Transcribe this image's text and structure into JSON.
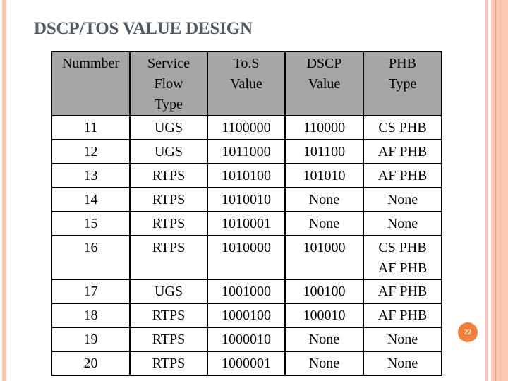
{
  "slide": {
    "title": "DSCP/TOS VALUE DESIGN",
    "slide_number": "22",
    "accent_color": "#f47f3a",
    "border_color": "#fbc3ae"
  },
  "table": {
    "headers": [
      [
        "Nummber"
      ],
      [
        "Service",
        "Flow",
        "Type"
      ],
      [
        "To.S",
        "Value"
      ],
      [
        "DSCP",
        "Value"
      ],
      [
        "PHB",
        "Type"
      ]
    ],
    "header_background": "#a6a6a6",
    "rows": [
      {
        "number": "11",
        "service_flow_type": "UGS",
        "tos_value": "1100000",
        "dscp_value": "110000",
        "phb_type": [
          "CS PHB"
        ]
      },
      {
        "number": "12",
        "service_flow_type": "UGS",
        "tos_value": "1011000",
        "dscp_value": "101100",
        "phb_type": [
          "AF PHB"
        ]
      },
      {
        "number": "13",
        "service_flow_type": "RTPS",
        "tos_value": "1010100",
        "dscp_value": "101010",
        "phb_type": [
          "AF PHB"
        ]
      },
      {
        "number": "14",
        "service_flow_type": "RTPS",
        "tos_value": "1010010",
        "dscp_value": "None",
        "phb_type": [
          "None"
        ]
      },
      {
        "number": "15",
        "service_flow_type": "RTPS",
        "tos_value": "1010001",
        "dscp_value": "None",
        "phb_type": [
          "None"
        ]
      },
      {
        "number": "16",
        "service_flow_type": "RTPS",
        "tos_value": "1010000",
        "dscp_value": "101000",
        "phb_type": [
          "CS PHB",
          "AF PHB"
        ]
      },
      {
        "number": "17",
        "service_flow_type": "UGS",
        "tos_value": "1001000",
        "dscp_value": "100100",
        "phb_type": [
          "AF PHB"
        ]
      },
      {
        "number": "18",
        "service_flow_type": "RTPS",
        "tos_value": "1000100",
        "dscp_value": "100010",
        "phb_type": [
          "AF PHB"
        ]
      },
      {
        "number": "19",
        "service_flow_type": "RTPS",
        "tos_value": "1000010",
        "dscp_value": "None",
        "phb_type": [
          "None"
        ]
      },
      {
        "number": "20",
        "service_flow_type": "RTPS",
        "tos_value": "1000001",
        "dscp_value": "None",
        "phb_type": [
          "None"
        ]
      }
    ]
  }
}
